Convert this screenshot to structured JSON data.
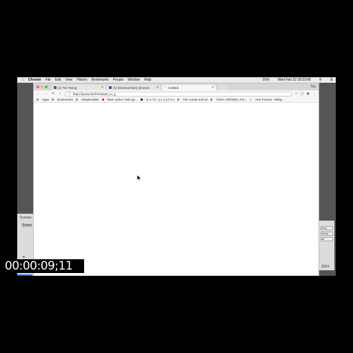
{
  "menubar": {
    "app": "Chrome",
    "items": [
      "File",
      "Edit",
      "View",
      "History",
      "Bookmarks",
      "People",
      "Window",
      "Help"
    ],
    "clock": "Wed Feb 22 18:23:06",
    "battery": "91%"
  },
  "background_app": {
    "left_label_1": "Scenes",
    "left_label_2": "Scene",
    "right_buttons": [
      "ning",
      "ading",
      "de"
    ],
    "right_year": "2024"
  },
  "browser": {
    "tabs": [
      {
        "label": "(1) Tim Tseng",
        "close": "×"
      },
      {
        "label": "(1) (timemachine) (timema",
        "close": "×"
      },
      {
        "label": "Untitled",
        "close": "×"
      }
    ],
    "profile": "Tim",
    "url": "https://youtu.be/FE0w8a0_iu_g",
    "bookmarks": [
      "Apps",
      "Bookmarks",
      "SimpleAdder",
      "Rare Aphex Twin ge...",
      "m o n k - p r o p h e t",
      "The Actual School",
      "TUNA CROWN | Fre...",
      "Arte Povera - Wikip..."
    ]
  },
  "overlay": {
    "timecode": "00:00:09;11"
  }
}
